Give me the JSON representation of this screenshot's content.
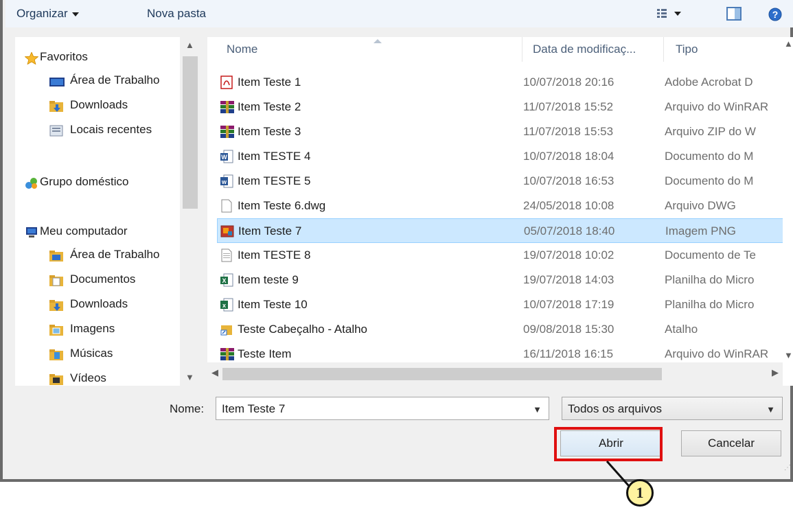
{
  "toolbar": {
    "organize_label": "Organizar",
    "new_folder_label": "Nova pasta",
    "view_icon": "view-list-icon",
    "preview_icon": "preview-pane-icon",
    "help_icon": "help-icon"
  },
  "nav": {
    "items": [
      {
        "label": "Favoritos",
        "icon": "star-icon"
      },
      {
        "label": "Área de Trabalho",
        "icon": "desktop-icon"
      },
      {
        "label": "Downloads",
        "icon": "downloads-folder-icon"
      },
      {
        "label": "Locais recentes",
        "icon": "recent-places-icon"
      },
      {
        "label": "Grupo doméstico",
        "icon": "homegroup-icon"
      },
      {
        "label": "Meu computador",
        "icon": "computer-icon"
      },
      {
        "label": "Área de Trabalho",
        "icon": "desktop-folder-icon"
      },
      {
        "label": "Documentos",
        "icon": "documents-folder-icon"
      },
      {
        "label": "Downloads",
        "icon": "downloads-folder-icon"
      },
      {
        "label": "Imagens",
        "icon": "pictures-folder-icon"
      },
      {
        "label": "Músicas",
        "icon": "music-folder-icon"
      },
      {
        "label": "Vídeos",
        "icon": "videos-folder-icon"
      }
    ]
  },
  "columns": {
    "name": "Nome",
    "date": "Data de modificaç...",
    "type": "Tipo"
  },
  "files": [
    {
      "name": "Item Teste 1",
      "date": "10/07/2018 20:16",
      "type": "Adobe Acrobat D",
      "icon": "pdf-icon"
    },
    {
      "name": "Item Teste 2",
      "date": "11/07/2018 15:52",
      "type": "Arquivo do WinRAR",
      "icon": "winrar-icon"
    },
    {
      "name": "Item Teste 3",
      "date": "11/07/2018 15:53",
      "type": "Arquivo ZIP do W",
      "icon": "winrar-icon"
    },
    {
      "name": "Item TESTE 4",
      "date": "10/07/2018 18:04",
      "type": "Documento do M",
      "icon": "word-doc-icon"
    },
    {
      "name": "Item TESTE 5",
      "date": "10/07/2018 16:53",
      "type": "Documento do M",
      "icon": "word-docx-icon"
    },
    {
      "name": "Item Teste 6.dwg",
      "date": "24/05/2018 10:08",
      "type": "Arquivo DWG",
      "icon": "blank-file-icon"
    },
    {
      "name": "Item Teste 7",
      "date": "05/07/2018 18:40",
      "type": "Imagem PNG",
      "icon": "png-image-icon",
      "selected": true
    },
    {
      "name": "Item TESTE 8",
      "date": "19/07/2018 10:02",
      "type": "Documento de Te",
      "icon": "text-file-icon"
    },
    {
      "name": "Item teste 9",
      "date": "19/07/2018 14:03",
      "type": "Planilha do Micro",
      "icon": "excel-xls-icon"
    },
    {
      "name": "Item Teste 10",
      "date": "10/07/2018 17:19",
      "type": "Planilha do Micro",
      "icon": "excel-xlsx-icon"
    },
    {
      "name": "Teste Cabeçalho - Atalho",
      "date": "09/08/2018 15:30",
      "type": "Atalho",
      "icon": "shortcut-icon"
    },
    {
      "name": "Teste Item",
      "date": "16/11/2018 16:15",
      "type": "Arquivo do WinRAR",
      "icon": "winrar-icon"
    }
  ],
  "bottom": {
    "name_label": "Nome:",
    "name_value": "Item Teste 7",
    "filter_value": "Todos os arquivos",
    "open_label": "Abrir",
    "cancel_label": "Cancelar"
  },
  "callout": {
    "number": "1"
  },
  "colors": {
    "highlight": "#e01010",
    "selection": "#cce8ff",
    "callout_fill": "#fff3a0"
  }
}
